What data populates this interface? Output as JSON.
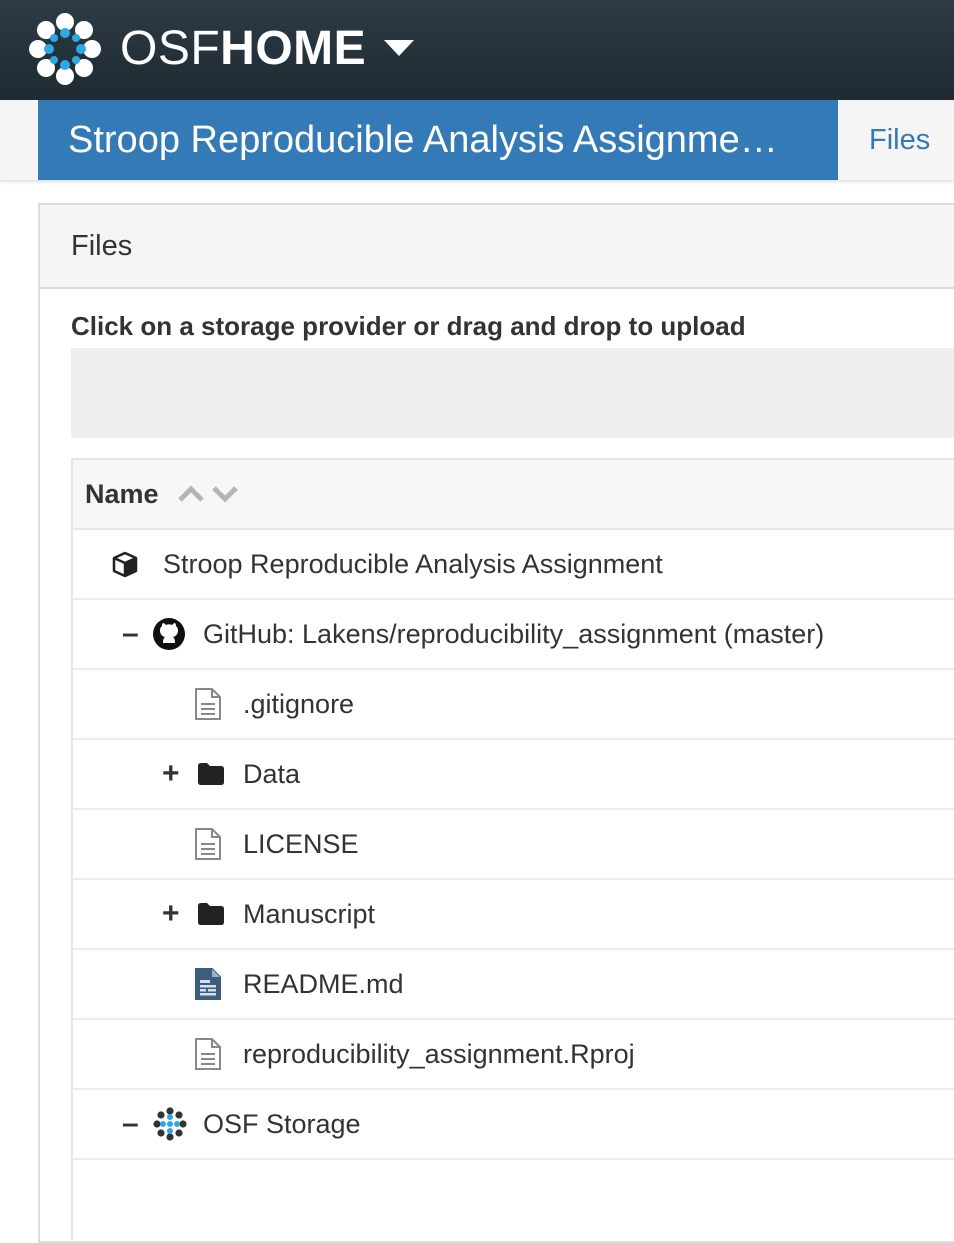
{
  "navbar": {
    "brand_light": "OSF",
    "brand_bold": "HOME",
    "logo_icon": "osf-logo-icon",
    "caret_icon": "caret-down-icon"
  },
  "project": {
    "title": "Stroop Reproducible Analysis Assignme…",
    "files_link": "Files"
  },
  "panel": {
    "heading": "Files",
    "upload_hint": "Click on a storage provider or drag and drop to upload"
  },
  "grid": {
    "column_name": "Name",
    "sort_asc_icon": "sort-ascending-icon",
    "sort_desc_icon": "sort-descending-icon",
    "rows": [
      {
        "label": "Stroop Reproducible Analysis Assignment",
        "icon": "project-cube-icon",
        "toggle": ""
      },
      {
        "label": "GitHub: Lakens/reproducibility_assignment (master)",
        "icon": "github-icon",
        "toggle": "–"
      },
      {
        "label": ".gitignore",
        "icon": "file-icon",
        "toggle": ""
      },
      {
        "label": "Data",
        "icon": "folder-icon",
        "toggle": "+"
      },
      {
        "label": "LICENSE",
        "icon": "file-icon",
        "toggle": ""
      },
      {
        "label": "Manuscript",
        "icon": "folder-icon",
        "toggle": "+"
      },
      {
        "label": "README.md",
        "icon": "markdown-file-icon",
        "toggle": ""
      },
      {
        "label": "reproducibility_assignment.Rproj",
        "icon": "file-icon",
        "toggle": ""
      },
      {
        "label": "OSF Storage",
        "icon": "osf-storage-icon",
        "toggle": "–"
      }
    ]
  },
  "colors": {
    "navbar_bg": "#263947",
    "project_title_bg": "#337ab7",
    "link": "#337ab7",
    "osf_blue": "#2ea8e5"
  }
}
